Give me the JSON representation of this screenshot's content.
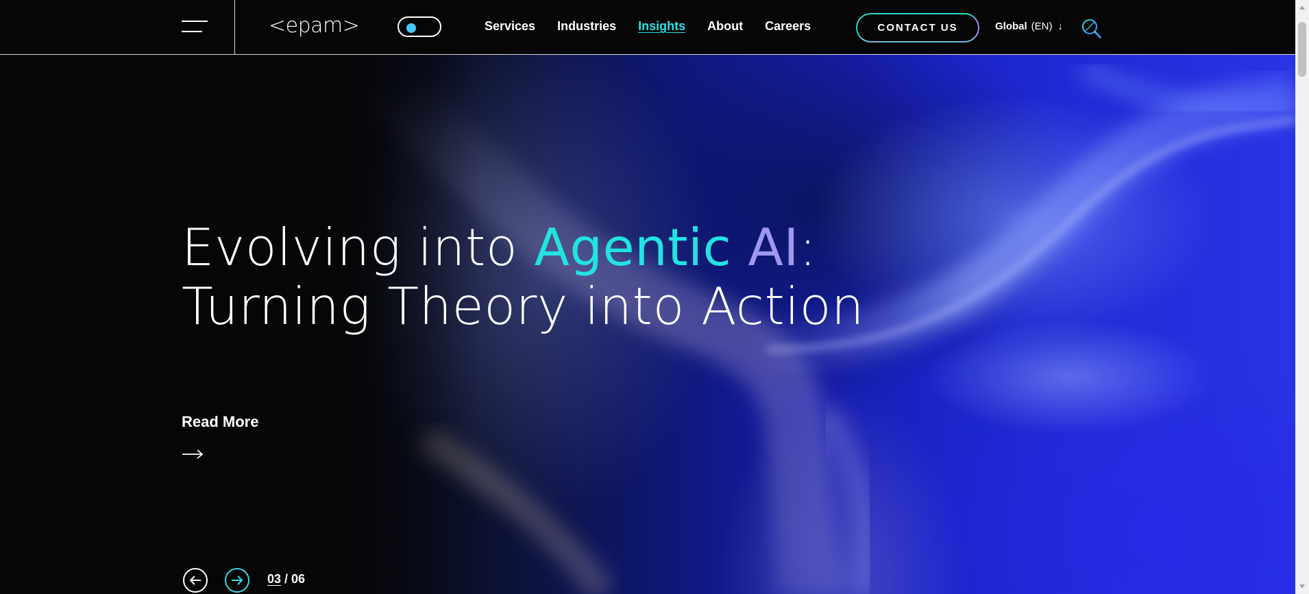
{
  "header": {
    "logo": "<epam>",
    "nav": [
      {
        "label": "Services",
        "active": false
      },
      {
        "label": "Industries",
        "active": false
      },
      {
        "label": "Insights",
        "active": true
      },
      {
        "label": "About",
        "active": false
      },
      {
        "label": "Careers",
        "active": false
      }
    ],
    "contact_label": "CONTACT US",
    "region_label": "Global",
    "region_code": "(EN)",
    "region_arrow": "↓"
  },
  "hero": {
    "headline_part1": "Evolving into ",
    "headline_accent1": "Agentic ",
    "headline_accent2": "AI",
    "headline_colon": ":",
    "headline_line2": "Turning Theory into Action",
    "read_more": "Read More",
    "slide_current": "03",
    "slide_separator": " / ",
    "slide_total": "06"
  },
  "colors": {
    "accent_teal": "#2de0e8",
    "accent_violet": "#9e98ee",
    "background": "#060606",
    "hero_blue": "#2a34e6"
  },
  "icons": [
    "menu-icon",
    "theme-toggle",
    "search-icon",
    "arrow-right-icon",
    "arrow-left-icon",
    "arrow-down-icon"
  ]
}
